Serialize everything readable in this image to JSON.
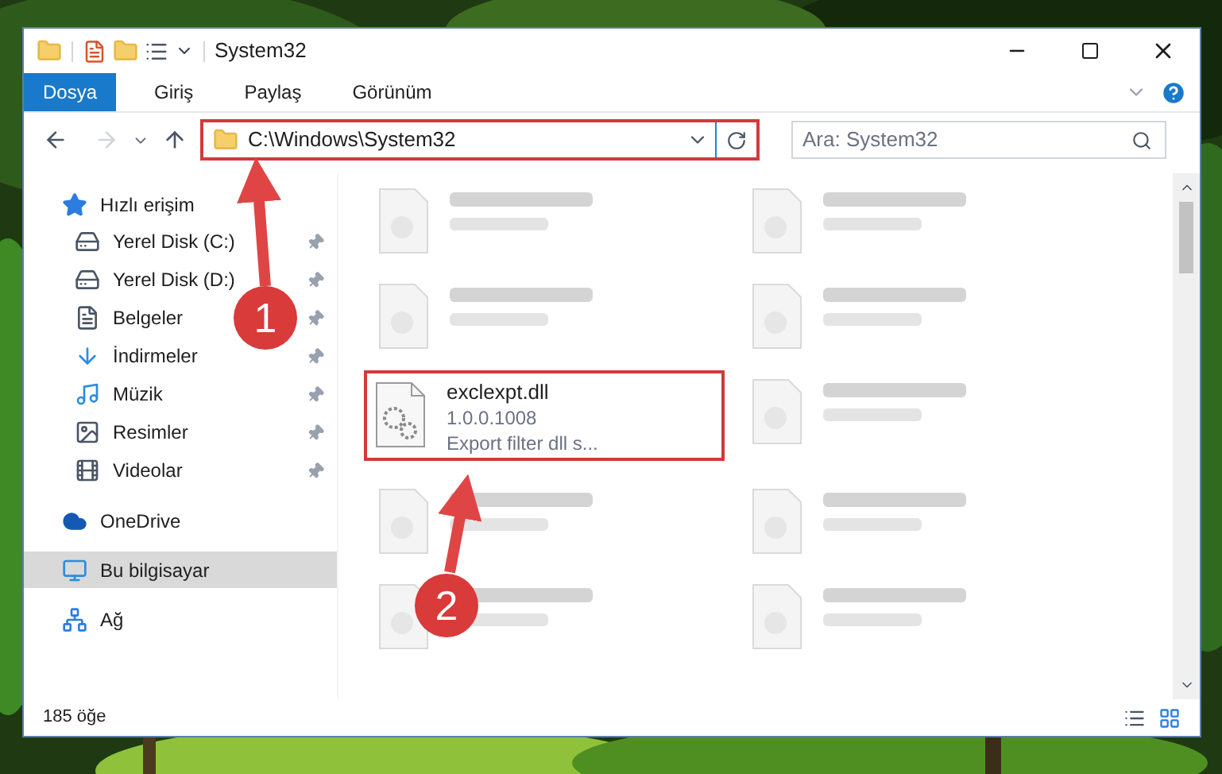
{
  "window": {
    "title": "System32"
  },
  "ribbon_tabs": [
    {
      "label": "Dosya",
      "selected": true
    },
    {
      "label": "Giriş",
      "selected": false
    },
    {
      "label": "Paylaş",
      "selected": false
    },
    {
      "label": "Görünüm",
      "selected": false
    }
  ],
  "address": {
    "path": "C:\\Windows\\System32",
    "highlighted": true
  },
  "search": {
    "placeholder": "Ara: System32"
  },
  "sidebar": {
    "items": [
      {
        "label": "Hızlı erişim",
        "selected": false,
        "children": [
          {
            "label": "Yerel Disk (C:)",
            "pinned": true
          },
          {
            "label": "Yerel Disk (D:)",
            "pinned": true
          },
          {
            "label": "Belgeler",
            "pinned": true
          },
          {
            "label": "İndirmeler",
            "pinned": true
          },
          {
            "label": "Müzik",
            "pinned": true
          },
          {
            "label": "Resimler",
            "pinned": true
          },
          {
            "label": "Videolar",
            "pinned": true
          }
        ]
      },
      {
        "label": "OneDrive",
        "selected": false
      },
      {
        "label": "Bu bilgisayar",
        "selected": true
      },
      {
        "label": "Ağ",
        "selected": false
      }
    ]
  },
  "files": [
    {
      "kind": "blurred"
    },
    {
      "kind": "blurred"
    },
    {
      "kind": "blurred"
    },
    {
      "kind": "blurred"
    },
    {
      "kind": "file",
      "name": "exclexpt.dll",
      "details": [
        "1.0.0.1008",
        "Export filter dll s..."
      ],
      "highlighted": true
    },
    {
      "kind": "blurred"
    },
    {
      "kind": "blurred"
    },
    {
      "kind": "blurred"
    },
    {
      "kind": "blurred"
    },
    {
      "kind": "blurred"
    }
  ],
  "status_bar": {
    "count": "185 öğe"
  },
  "annotations": [
    {
      "label": "1"
    },
    {
      "label": "2"
    }
  ]
}
